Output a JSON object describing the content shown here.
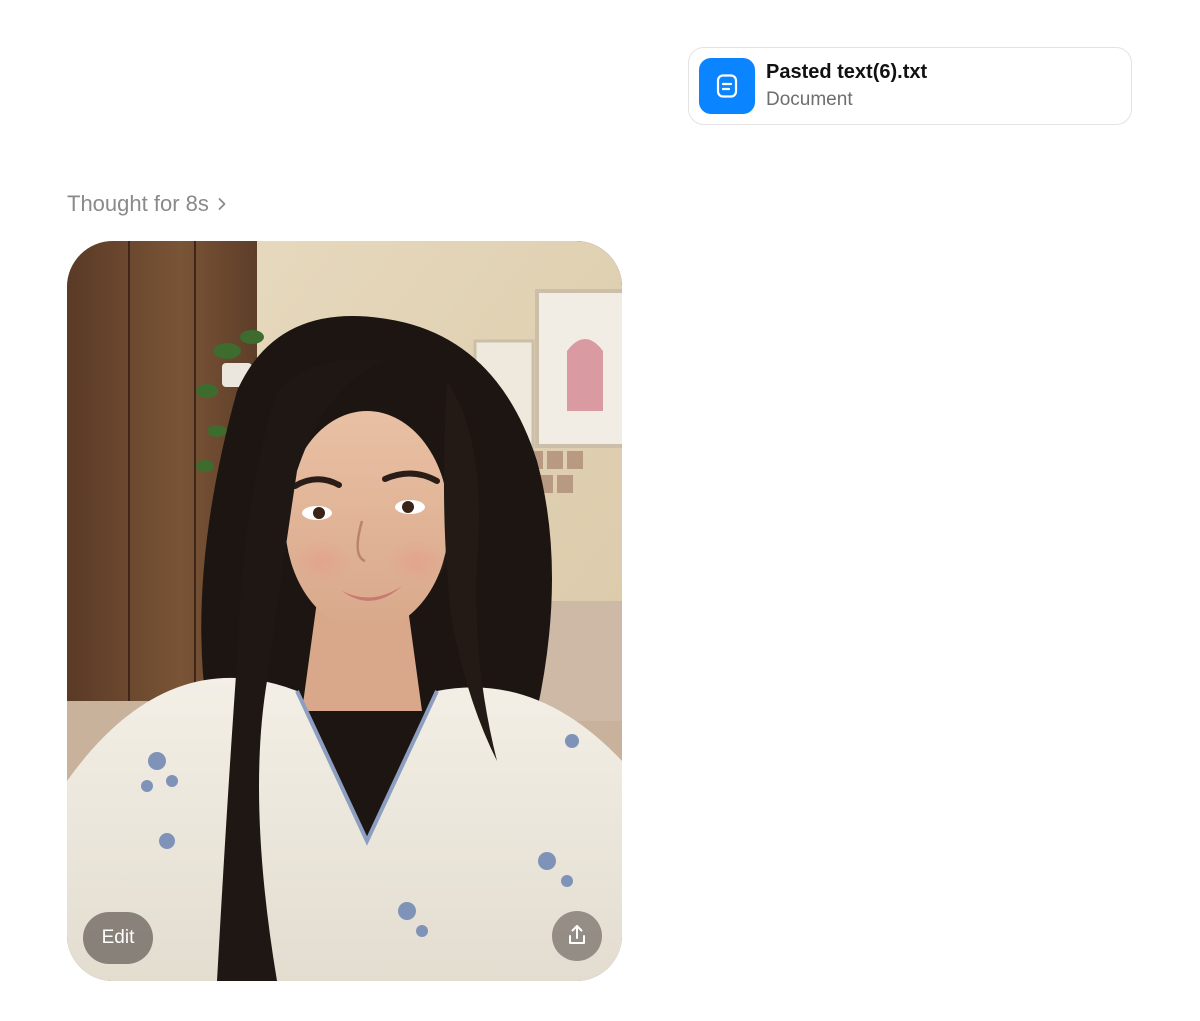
{
  "attachment": {
    "file_name": "Pasted text(6).txt",
    "file_type": "Document",
    "icon": "document-icon",
    "accent_color": "#0a84ff"
  },
  "thought": {
    "label": "Thought for 8s",
    "icon": "chevron-right-icon"
  },
  "generated_image": {
    "description_icon": "photo",
    "edit_label": "Edit",
    "share_icon": "share-icon"
  }
}
